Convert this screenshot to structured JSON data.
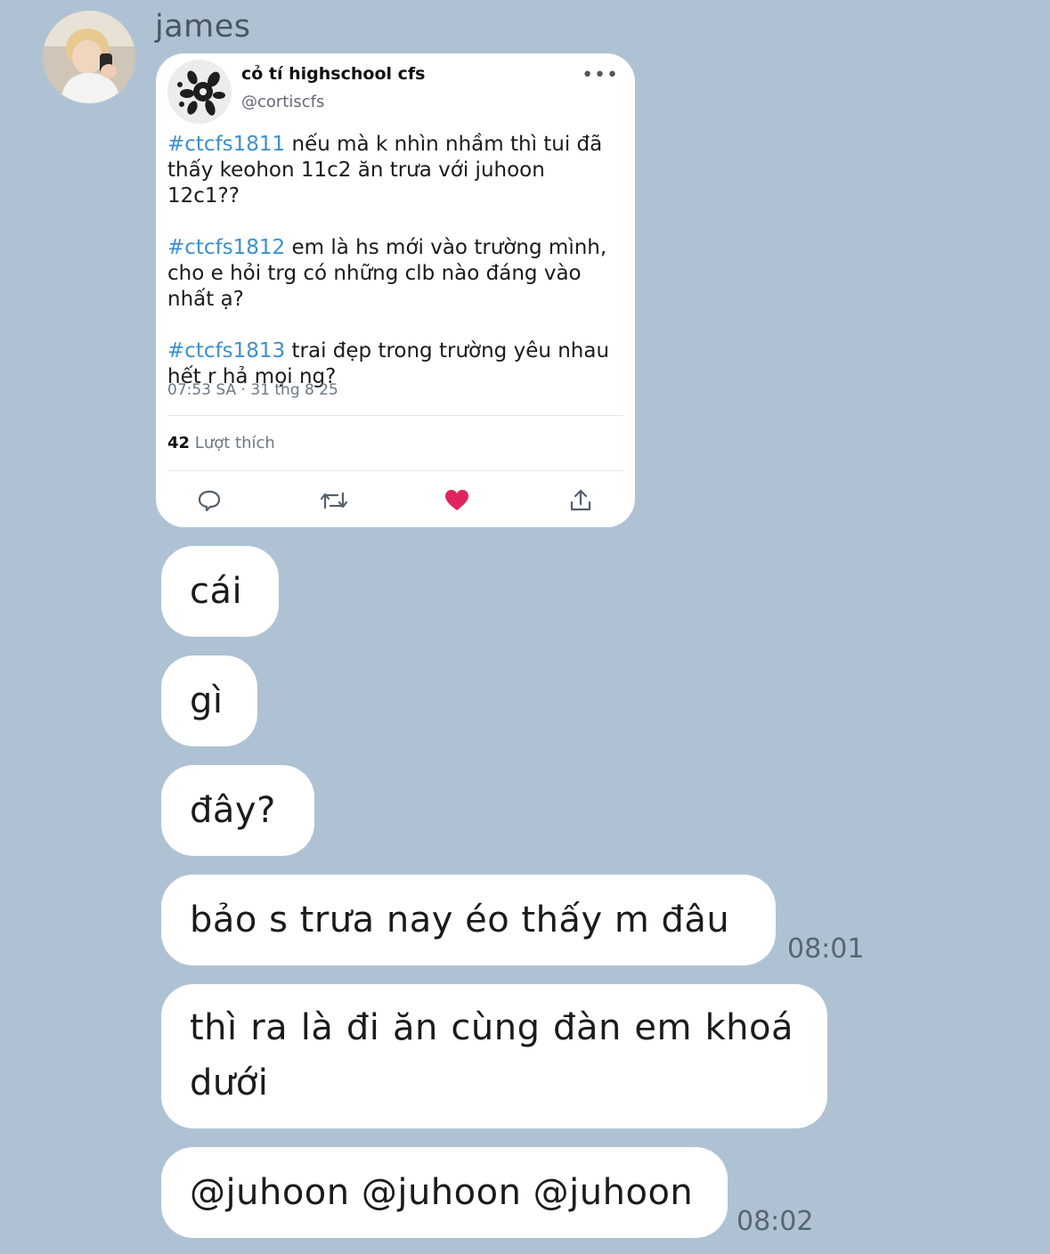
{
  "sender": {
    "name": "james"
  },
  "tweet": {
    "display_name": "cỏ tí highschool cfs",
    "handle": "@cortiscfs",
    "more": "•••",
    "posts": [
      {
        "tag": "#ctcfs1811",
        "text": " nếu mà k nhìn nhầm thì tui đã thấy keohon 11c2 ăn trưa với juhoon 12c1??"
      },
      {
        "tag": "#ctcfs1812",
        "text": " em là hs mới vào trường mình, cho e hỏi trg có những clb nào đáng vào nhất ạ?"
      },
      {
        "tag": "#ctcfs1813",
        "text": " trai đẹp trong trường yêu nhau hết r hả mọi ng?"
      }
    ],
    "timestamp": "07:53 SA · 31 thg 8 25",
    "likes_count": "42",
    "likes_label": "Lượt thích",
    "actions": [
      "reply-icon",
      "retweet-icon",
      "like-icon",
      "share-icon"
    ],
    "like_color": "#e0245e"
  },
  "messages": [
    {
      "text": "cái"
    },
    {
      "text": "gì"
    },
    {
      "text": "đây?"
    },
    {
      "text": "bảo s trưa nay éo thấy m đâu",
      "time": "08:01"
    },
    {
      "text": "thì ra là đi ăn cùng đàn em khoá dưới"
    },
    {
      "text": "@juhoon @juhoon @juhoon",
      "time": "08:02"
    }
  ]
}
